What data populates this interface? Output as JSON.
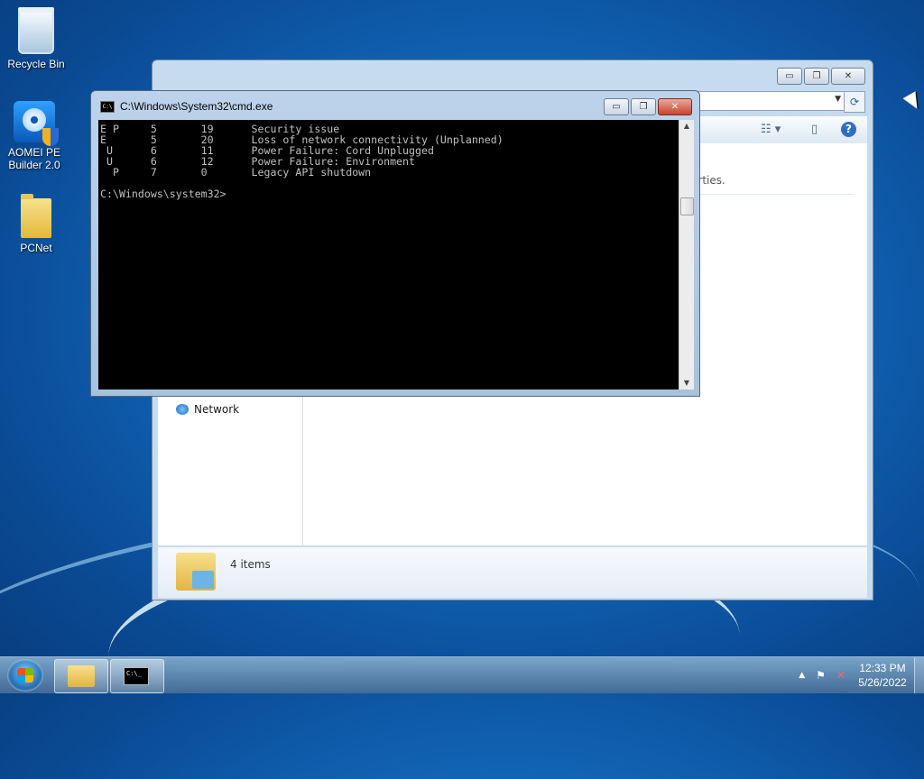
{
  "desktop": {
    "icons": [
      {
        "label": "Recycle Bin",
        "icon": "recycle-bin-icon"
      },
      {
        "label": "AOMEI PE\nBuilder 2.0",
        "icon": "aomei-pe-builder-icon"
      },
      {
        "label": "PCNet",
        "icon": "folder-icon"
      }
    ]
  },
  "explorer": {
    "left_pane": {
      "network_label": "Network"
    },
    "details_text": "erties.",
    "status_count": "4 items"
  },
  "cmd": {
    "title": "C:\\Windows\\System32\\cmd.exe",
    "console_text": "E P     5       19      Security issue\nE       5       20      Loss of network connectivity (Unplanned)\n U      6       11      Power Failure: Cord Unplugged\n U      6       12      Power Failure: Environment\n  P     7       0       Legacy API shutdown\n\nC:\\Windows\\system32>"
  },
  "taskbar": {
    "pinned": [
      {
        "name": "windows-explorer",
        "icon": "folder-icon"
      },
      {
        "name": "command-prompt",
        "icon": "cmd-icon",
        "glyph": "C:\\_"
      }
    ],
    "tray": {
      "show_hidden_label": "▲",
      "time": "12:33 PM",
      "date": "5/26/2022"
    }
  },
  "window_buttons": {
    "minimize": "▭",
    "maximize": "❐",
    "close": "✕"
  }
}
